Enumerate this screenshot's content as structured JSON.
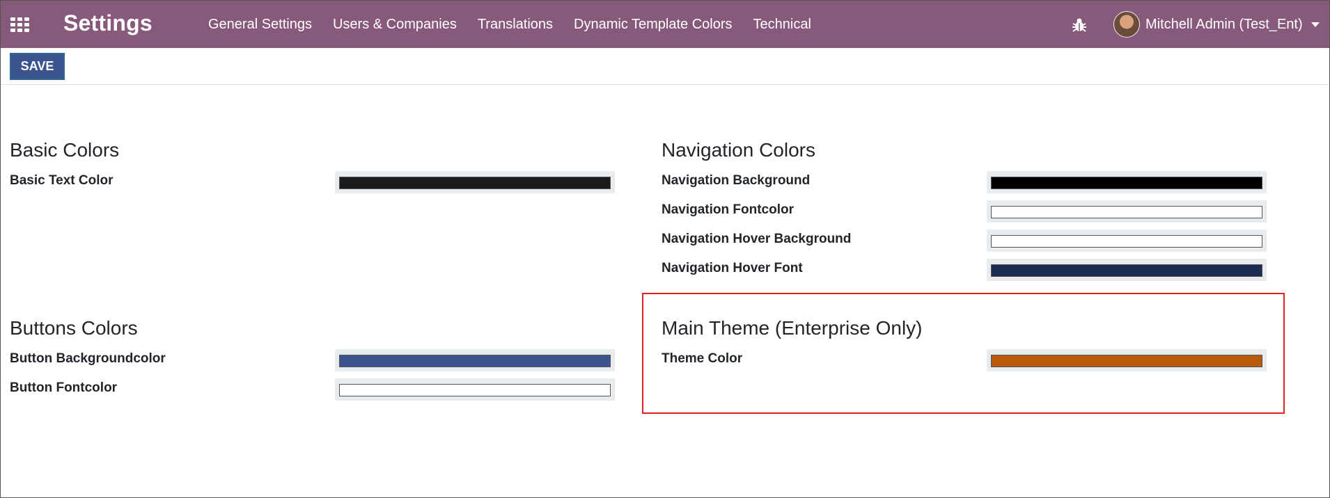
{
  "navbar": {
    "app_title": "Settings",
    "menu": [
      {
        "label": "General Settings"
      },
      {
        "label": "Users & Companies"
      },
      {
        "label": "Translations"
      },
      {
        "label": "Dynamic Template Colors"
      },
      {
        "label": "Technical"
      }
    ],
    "user_name": "Mitchell Admin (Test_Ent)"
  },
  "control_panel": {
    "save_label": "SAVE"
  },
  "sections": {
    "basic": {
      "title": "Basic Colors",
      "fields": [
        {
          "label": "Basic Text Color",
          "color": "#1a1a1a"
        }
      ]
    },
    "navigation": {
      "title": "Navigation Colors",
      "fields": [
        {
          "label": "Navigation Background",
          "color": "#000000"
        },
        {
          "label": "Navigation Fontcolor",
          "color": "#ffffff"
        },
        {
          "label": "Navigation Hover Background",
          "color": "#ffffff"
        },
        {
          "label": "Navigation Hover Font",
          "color": "#1c2b50"
        }
      ]
    },
    "buttons": {
      "title": "Buttons Colors",
      "fields": [
        {
          "label": "Button Backgroundcolor",
          "color": "#3b5490"
        },
        {
          "label": "Button Fontcolor",
          "color": "#ffffff"
        }
      ]
    },
    "theme": {
      "title": "Main Theme (Enterprise Only)",
      "fields": [
        {
          "label": "Theme Color",
          "color": "#b85a0a"
        }
      ]
    }
  },
  "colors": {
    "navbar_bg": "#875a7b",
    "save_button_bg": "#3b5490",
    "highlight_border": "#e02020"
  }
}
